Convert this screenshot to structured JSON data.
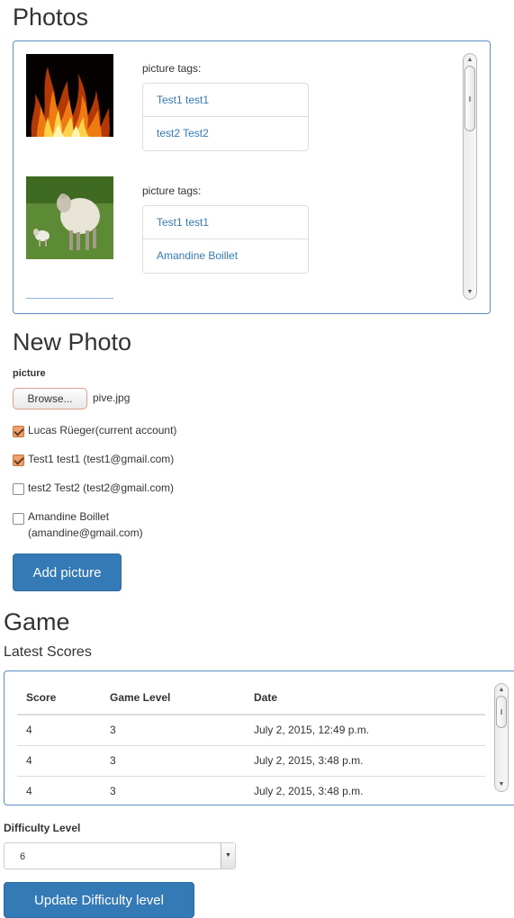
{
  "photos_section": {
    "title": "Photos",
    "entries": [
      {
        "image": "fire-photo",
        "tags_label": "picture tags:",
        "tags": [
          "Test1 test1",
          "test2 Test2"
        ]
      },
      {
        "image": "sheep-photo",
        "tags_label": "picture tags:",
        "tags": [
          "Test1 test1",
          "Amandine Boillet"
        ]
      }
    ]
  },
  "new_photo": {
    "title": "New Photo",
    "picture_label": "picture",
    "browse_label": "Browse...",
    "file_name": "pive.jpg",
    "users": [
      {
        "label": "Lucas Rüeger(current account)",
        "checked": true
      },
      {
        "label": "Test1 test1 (test1@gmail.com)",
        "checked": true
      },
      {
        "label": "test2 Test2 (test2@gmail.com)",
        "checked": false
      },
      {
        "label_line1": "Amandine Boillet",
        "label_line2": "(amandine@gmail.com)",
        "checked": false
      }
    ],
    "submit_label": "Add picture"
  },
  "game": {
    "title": "Game",
    "latest_scores_title": "Latest Scores",
    "columns": [
      "Score",
      "Game Level",
      "Date"
    ],
    "rows": [
      [
        "4",
        "3",
        "July 2, 2015, 12:49 p.m."
      ],
      [
        "4",
        "3",
        "July 2, 2015, 3:48 p.m."
      ],
      [
        "4",
        "3",
        "July 2, 2015, 3:48 p.m."
      ]
    ],
    "difficulty_label": "Difficulty Level",
    "difficulty_value": "6",
    "update_label": "Update Difficulty level"
  },
  "colors": {
    "primary": "#337ab7",
    "link": "#337ab7",
    "panel_border": "#5b8fc6",
    "checkbox_checked": "#f0a070"
  }
}
